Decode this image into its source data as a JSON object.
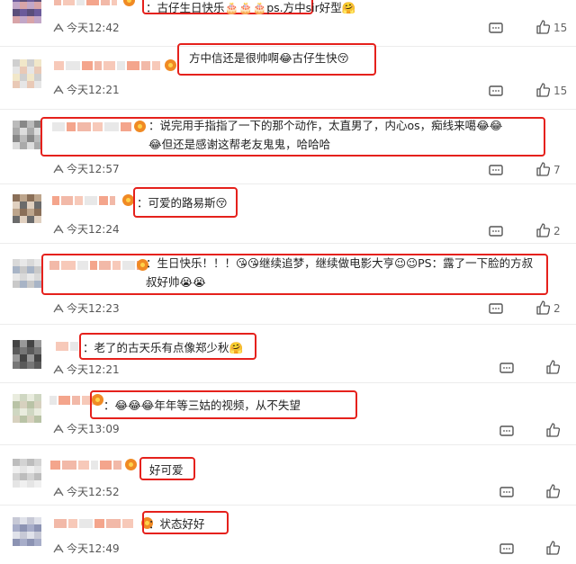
{
  "comments": [
    {
      "time": "今天12:42",
      "likes": "15",
      "text": "：古仔生日快乐🎂🎂🎂ps.方中sir好型🤗"
    },
    {
      "time": "今天12:21",
      "likes": "15",
      "text": "方中信还是很帅啊😂古仔生快😚"
    },
    {
      "time": "今天12:57",
      "likes": "7",
      "text": "：说完用手指指了一下的那个动作，太直男了，内心os，痴线来噶😂😂😂但还是感谢这帮老友鬼鬼，哈哈哈"
    },
    {
      "time": "今天12:24",
      "likes": "2",
      "text": "：可爱的路易斯😚"
    },
    {
      "time": "今天12:23",
      "likes": "2",
      "text": "：生日快乐！！！😘😘继续追梦，继续做电影大亨😉😉PS：露了一下脸的方叔叔好帅😭😭"
    },
    {
      "time": "今天12:21",
      "likes": "",
      "text": "：老了的古天乐有点像郑少秋🤗"
    },
    {
      "time": "今天13:09",
      "likes": "",
      "text": "：😂😂😂年年等三姑的视频，从不失望"
    },
    {
      "time": "今天12:52",
      "likes": "",
      "text": "好可爱"
    },
    {
      "time": "今天12:49",
      "likes": "",
      "text": "：状态好好"
    }
  ],
  "icons": {
    "reply": "comment-icon",
    "like": "thumbs-up-icon",
    "clock": "clock-icon"
  },
  "colors": {
    "highlight": "#e5211c",
    "vip": "#f08a24"
  }
}
